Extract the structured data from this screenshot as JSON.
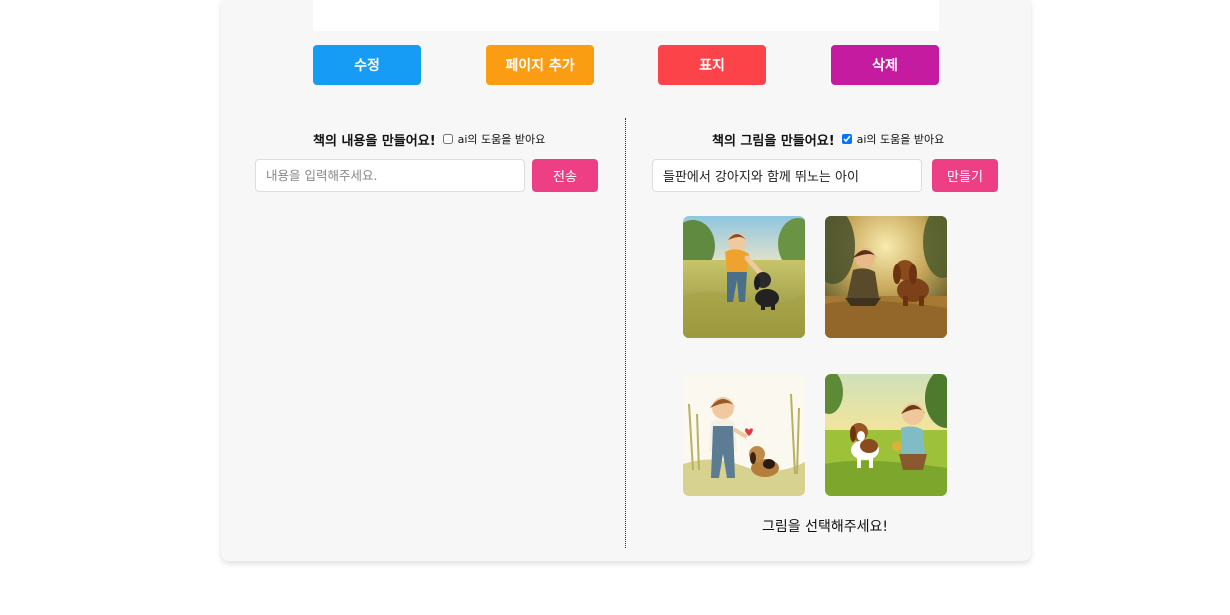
{
  "toolbar": {
    "edit_label": "수정",
    "add_page_label": "페이지 추가",
    "cover_label": "표지",
    "delete_label": "삭제"
  },
  "text_panel": {
    "title": "책의 내용을 만들어요!",
    "ai_help_label": "ai의 도움을 받아요",
    "ai_help_checked": false,
    "input_placeholder": "내용을 입력해주세요.",
    "input_value": "",
    "submit_label": "전송"
  },
  "image_panel": {
    "title": "책의 그림을 만들어요!",
    "ai_help_label": "ai의 도움을 받아요",
    "ai_help_checked": true,
    "prompt_value": "들판에서 강아지와 함께 뛰노는 아이",
    "generate_label": "만들기",
    "images": [
      {
        "name": "generated-image-1"
      },
      {
        "name": "generated-image-2"
      },
      {
        "name": "generated-image-3"
      },
      {
        "name": "generated-image-4"
      }
    ],
    "select_prompt": "그림을 선택해주세요!"
  },
  "colors": {
    "edit": "#169cf5",
    "add_page": "#fb9d12",
    "cover": "#fc434a",
    "delete": "#c41ba0",
    "submit": "#ee3f85"
  }
}
